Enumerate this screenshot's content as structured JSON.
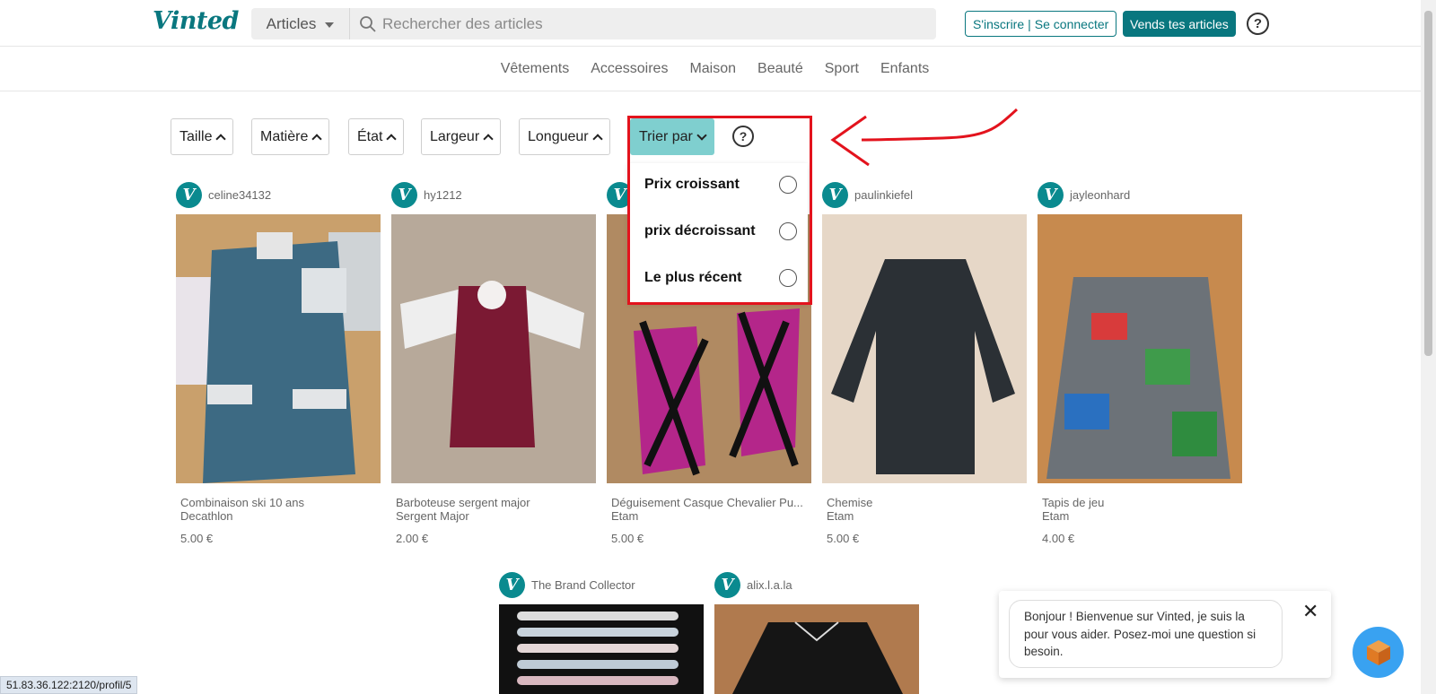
{
  "header": {
    "logo": "Vinted",
    "category_select": "Articles",
    "search_placeholder": "Rechercher des articles",
    "signup_label": "S'inscrire",
    "login_label": "Se connecter",
    "sell_label": "Vends tes articles",
    "help_symbol": "?"
  },
  "nav": [
    "Vêtements",
    "Accessoires",
    "Maison",
    "Beauté",
    "Sport",
    "Enfants"
  ],
  "filters": [
    "Taille",
    "Matière",
    "État",
    "Largeur",
    "Longueur"
  ],
  "sort": {
    "label": "Trier par",
    "help_symbol": "?",
    "options": [
      "Prix croissant",
      "prix décroissant",
      "Le plus récent"
    ]
  },
  "items": [
    {
      "user": "celine34132",
      "title": "Combinaison ski 10 ans",
      "brand": "Decathlon",
      "price": "5.00 €"
    },
    {
      "user": "hy1212",
      "title": "Barboteuse sergent major",
      "brand": "Sergent Major",
      "price": "2.00 €"
    },
    {
      "user": "",
      "title": "Déguisement Casque Chevalier Pu...",
      "brand": "Etam",
      "price": "5.00 €"
    },
    {
      "user": "paulinkiefel",
      "title": "Chemise",
      "brand": "Etam",
      "price": "5.00 €"
    },
    {
      "user": "jayleonhard",
      "title": "Tapis de jeu",
      "brand": "Etam",
      "price": "4.00 €"
    },
    {
      "user": "The Brand Collector",
      "title": "",
      "brand": "",
      "price": ""
    },
    {
      "user": "alix.l.a.la",
      "title": "",
      "brand": "",
      "price": ""
    }
  ],
  "avatar_letter": "V",
  "chat": {
    "message": "Bonjour ! Bienvenue sur Vinted, je suis la pour vous aider. Posez-moi une question si besoin.",
    "close": "✕"
  },
  "status_url": "51.83.36.122:2120/profil/5",
  "colors": {
    "brand": "#09777f",
    "sort_active": "#7fcfcf",
    "annotation_red": "#e3131d"
  }
}
